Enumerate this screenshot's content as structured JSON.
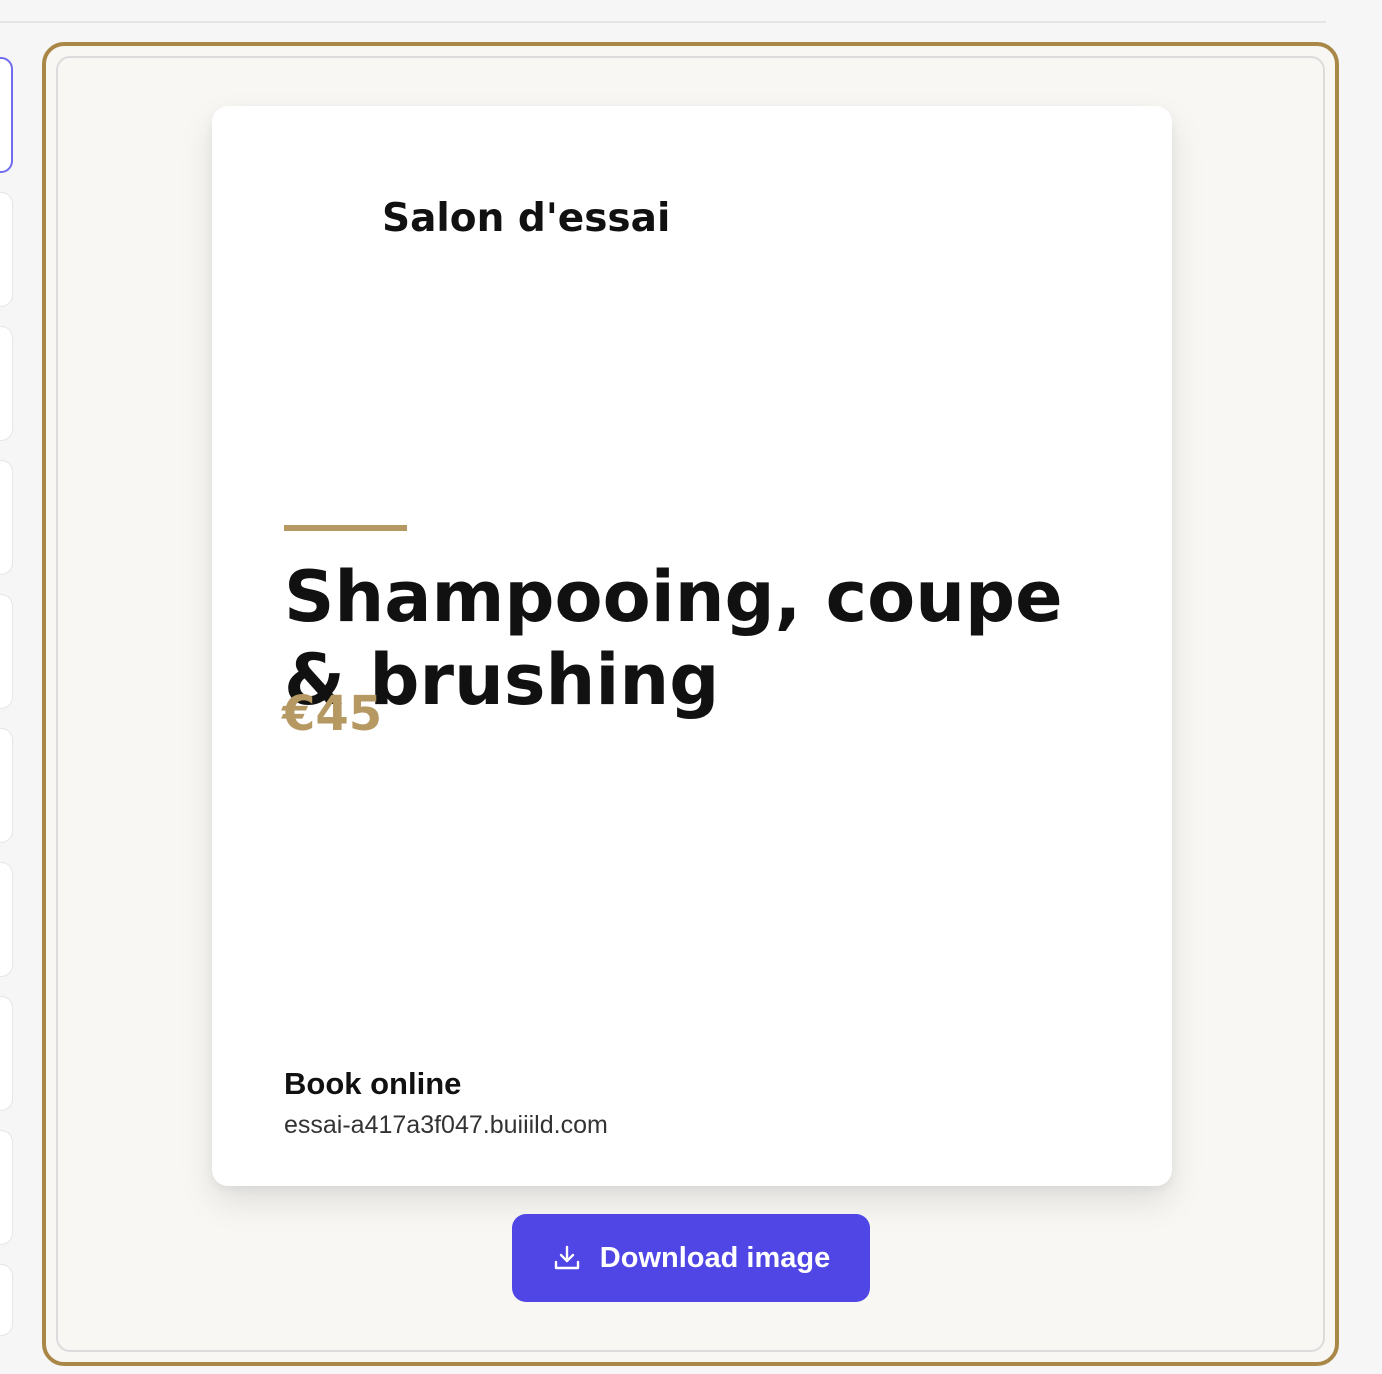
{
  "poster": {
    "salon_name": "Salon d'essai",
    "service_title": "Shampooing, coupe & brushing",
    "price": "€45",
    "book_label": "Book online",
    "book_url": "essai-a417a3f047.buiiild.com"
  },
  "actions": {
    "download_label": "Download image",
    "download_icon": "download-icon"
  },
  "colors": {
    "accent": "#b59862",
    "frame": "#a98747",
    "button": "#4f46e5"
  }
}
